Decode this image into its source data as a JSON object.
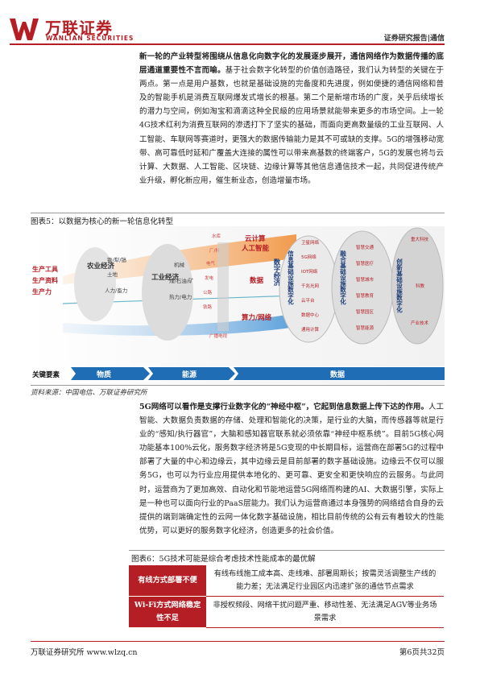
{
  "header": {
    "logo_cn": "万联证券",
    "logo_en": "WANLIAN SECURITIES",
    "report_type": "证券研究报告|通信"
  },
  "para1": {
    "bold": "新一轮的产业转型将围绕从信息化向数字化的发展逐步展开，通信网络作为数据传播的底层通道重要性不言而喻。",
    "text": "基于社会数字化转型的价值创造路径，我们认为转型的关键在于两点。第一点是用户基数，也就是基础设施的完备度和先进度，例如便捷的通信网络和普及的智能手机是消费互联网爆发式增长的根基。第二个是新增市场的广度，关乎后续增长的潜力与空间，例如淘宝和滴滴这种全民級的应用场景就能带来更多的市场空间。上一轮4G技术红利为消费互联网的渗透打下了坚实的基础，而面向更高数量级的工业互联网、人工智能、车联网等赛道时，更强大的数据传输能力是其不可或缺的支撑。5G的增强移动宽带、高可靠低时延和广覆盖大连接的属性可以带来高基数的终端客户，5G的发展也将与云计算、大数据、人工智能、区块链、边缘计算等其他信息通信技术一起，共同促进传统产业升级，孵化新应用，催生新业态，创造增量市场。"
  },
  "figure5": {
    "title": "图表5：以数据为核心的新一轮信息化转型",
    "source": "资料来源：中国电信、万联证券研究所",
    "left_labels": [
      "生产工具",
      "生产资料",
      "生产力"
    ],
    "stage_labels": [
      "农业经济",
      "工业经济",
      "数字经济",
      "信息基础设施数字化",
      "融合基础设施数字化",
      "创新基础设施数字化"
    ],
    "agri_items": [
      "锄/犁/镐",
      "土地",
      "人力/畜力"
    ],
    "industry_items": [
      "机械",
      "煤/石油/矿",
      "热力/电力"
    ],
    "digital_items": [
      "云计算",
      "人工智能",
      "数据",
      "算力/网络"
    ],
    "scatter_labels": [
      "水库",
      "厂/科",
      "电气",
      "发电",
      "公路",
      "铁路",
      "广播电视"
    ],
    "info_items": [
      "卫星网络",
      "5G网络",
      "IOT网络",
      "千兆光网",
      "云平台",
      "数据中心",
      "通用计算"
    ],
    "fusion_items": [
      "智慧交通",
      "智慧医疗",
      "智慧城市",
      "智慧教育",
      "智慧园区",
      "智慧能源"
    ],
    "innovation_items": [
      "重大科技",
      "科教",
      "产业技术"
    ],
    "key_factor_label": "关键要素",
    "key_factors": [
      "物质",
      "能源",
      "数据"
    ],
    "colors": {
      "accent": "#b51e24",
      "blue": "#1f6db4",
      "orange": "#e8741e"
    }
  },
  "para2": {
    "bold": "5G网络可以看作是支撑行业数字化的“神经中枢”，它起到信息数据上传下达的作用。",
    "text": "人工智能、大数据负责数据的存储、处理和智能化的决策，是行业的大脑，而传感器等就是行业的“感知/执行器官”，大脑和感知器官联系就必须依靠“神经中枢系统”。目前5G核心网功能基本100%云化，服务数字经济将是5G变现的中长期目标，运营商在部署5G的过程中部署了大量的中心和边缘云，其中边缘云是目前部署的数字基础设施。边缘云不仅可以服务5G，也可以为行业应用提供本地化的、更可靠、更安全和更快响应的云服务。与此同时，运营商为了更加高效、自动化和节能地运营5G网络而构建的AI、大数据引擎，实际上是一种也可以面向行业的PaaS层能力。我们认为运营商通过本身强势的网络结合自身的云提供的端到端确定性的云网一体化数字基础设施，相比目前传统的公有云有着较大的性能优势，可以更好的服务数字化经济，创造更多的社会价值。"
  },
  "table6": {
    "title": "图表6：5G技术可能是综合考虑技术性能成本的最优解",
    "rows": [
      {
        "key": "有线方式部署不便",
        "value": "有线布线施工成本高、走线难、部署周期长；按需灵活调整生产线的能力差；无法满足行业园区内迅速扩张的通信节点需求"
      },
      {
        "key": "Wi-Fi方式网络稳定性不足",
        "value": "非授权频段、网络干扰问题严重、移动性差、无法满足AGV等业务场景需求"
      }
    ]
  },
  "footer": {
    "left": "万联证券研究所 www.wlzq.cn",
    "right": "第6页共32页"
  }
}
